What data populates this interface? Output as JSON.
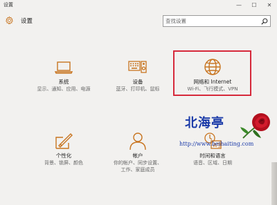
{
  "window": {
    "title": "设置",
    "controls": [
      "—",
      "☐",
      "✕"
    ]
  },
  "header": {
    "title": "设置",
    "search": {
      "placeholder": "查找设置"
    }
  },
  "tiles": [
    {
      "name": "系统",
      "sub": "显示、通知、应用、电源",
      "icon": "laptop-icon"
    },
    {
      "name": "设备",
      "sub": "蓝牙、打印机、鼠标",
      "icon": "keyboard-speaker-icon"
    },
    {
      "name": "网络和 Internet",
      "sub": "Wi-Fi、飞行模式、VPN",
      "icon": "globe-icon"
    },
    {
      "name": "个性化",
      "sub": "背景、锁屏、颜色",
      "icon": "brush-icon"
    },
    {
      "name": "帐户",
      "sub_lines": [
        "你的帐户、同步设置、",
        "工作、家庭成员"
      ],
      "icon": "person-icon"
    },
    {
      "name": "时间和语言",
      "sub": "语音、区域、日期",
      "icon": "time-language-icon"
    }
  ],
  "watermark": {
    "chinese": "北海亭",
    "url": "http://www.beihaiting.com"
  },
  "colors": {
    "accent": "#c8741f",
    "highlight_border": "#d6283a",
    "watermark_text": "#1a3aa8"
  }
}
